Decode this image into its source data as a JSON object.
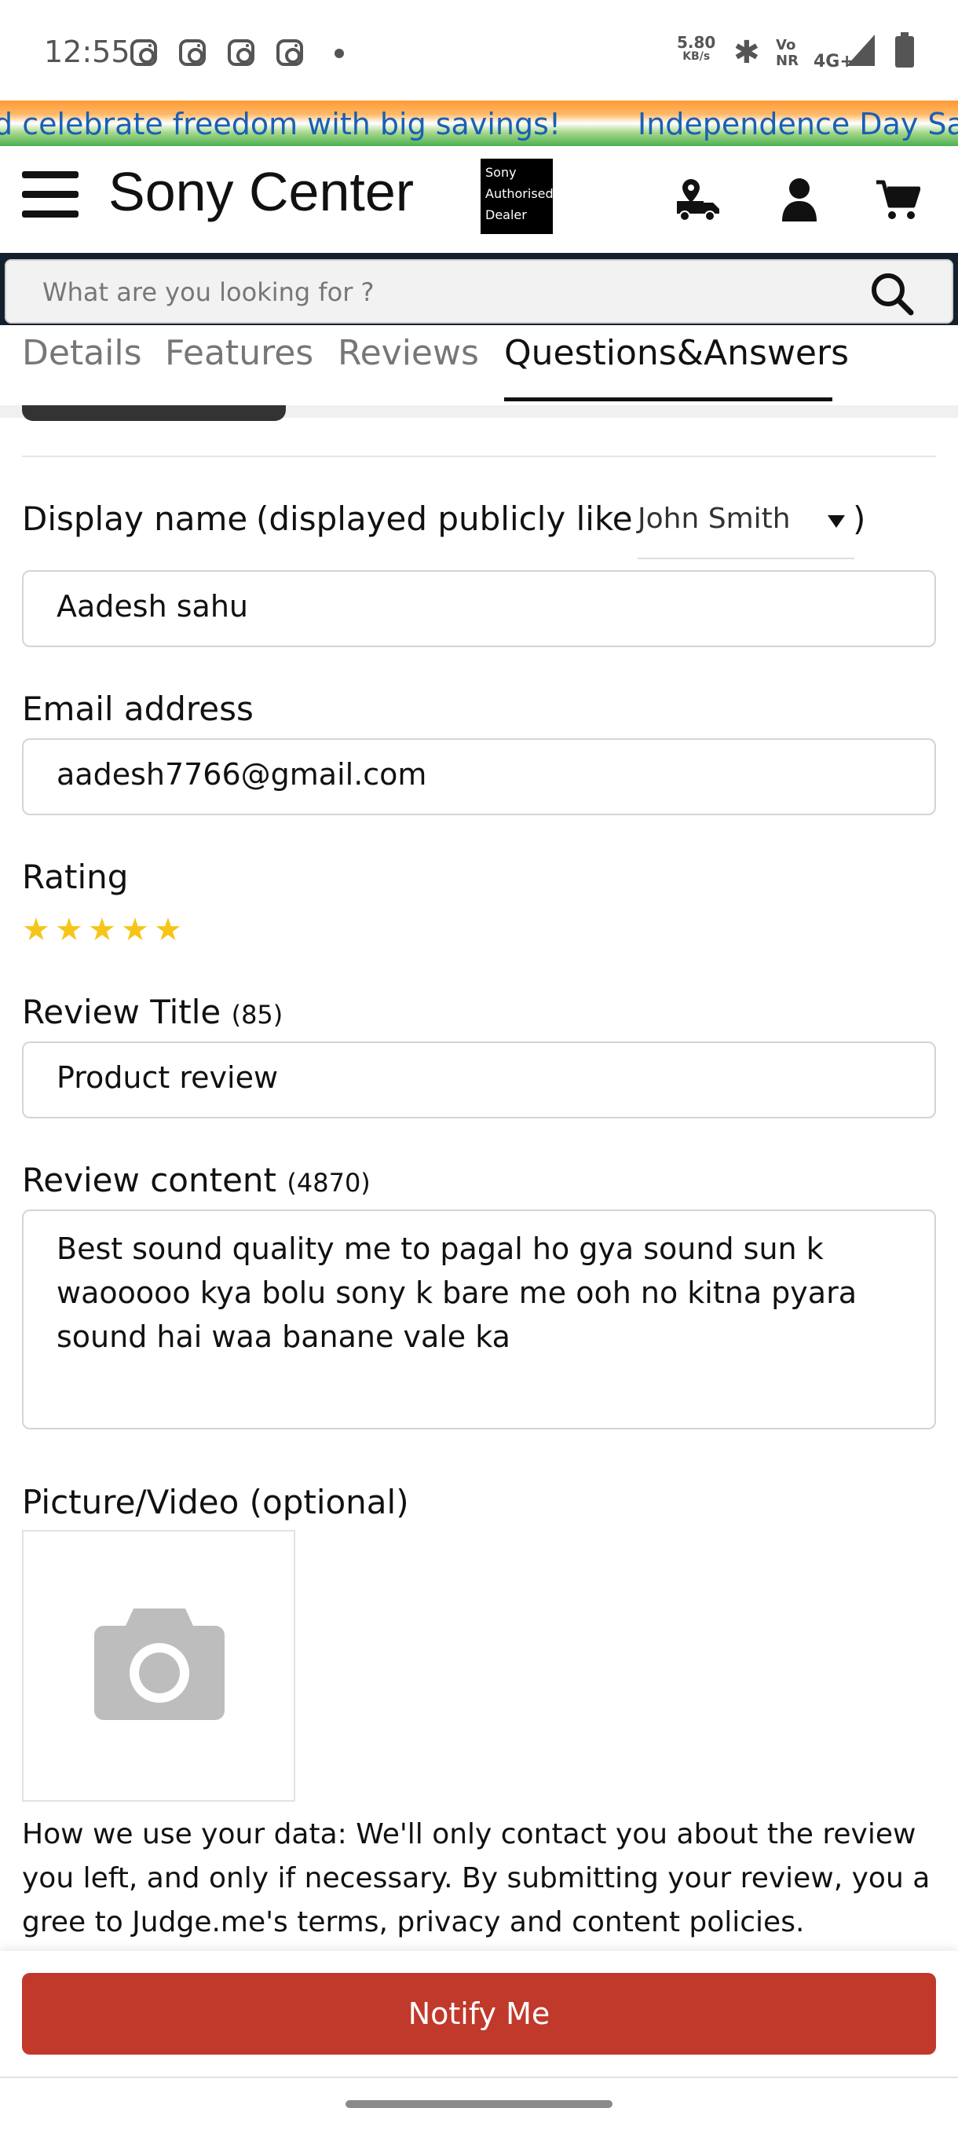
{
  "status_bar": {
    "time": "12:55",
    "speed": "5.80",
    "speed_unit": "KB/s",
    "vonr": "Vo\nNR",
    "network": "4G+"
  },
  "banner": {
    "message_1": "d celebrate freedom with big savings!",
    "message_2": "Independence Day Sale"
  },
  "header": {
    "brand": "Sony Center",
    "badge_line_1": "Sony",
    "badge_line_2": "Authorised",
    "badge_line_3": "Dealer"
  },
  "search": {
    "placeholder": "What are you looking for ?"
  },
  "tabs": [
    {
      "label": "Details"
    },
    {
      "label": "Features"
    },
    {
      "label": "Reviews"
    },
    {
      "label": "Questions&Answers"
    }
  ],
  "form": {
    "display_name_label": "Display name",
    "display_hint": "(displayed publicly like",
    "display_select_value": "John Smith",
    "display_close": ")",
    "display_name_value": "Aadesh sahu",
    "email_label": "Email address",
    "email_value": "aadesh7766@gmail.com",
    "rating_label": "Rating",
    "rating_value": 5,
    "rating_max": 5,
    "review_title_label": "Review Title",
    "review_title_count": "(85)",
    "review_title_value": "Product review",
    "review_content_label": "Review content",
    "review_content_count": "(4870)",
    "review_content_value": "Best sound quality me to pagal ho gya sound sun k waooooo kya bolu sony k bare me ooh no kitna pyara sound hai waa banane vale ka",
    "media_label": "Picture/Video (optional)",
    "privacy_text": "How we use your data: We'll only contact you about the review you left, and only if necessary. By submitting your review, you a gree to Judge.me's terms, privacy and content policies."
  },
  "actions": {
    "notify_label": "Notify Me"
  },
  "colors": {
    "accent": "#c0392b",
    "star": "#f5c518",
    "search_band": "#15202e"
  }
}
